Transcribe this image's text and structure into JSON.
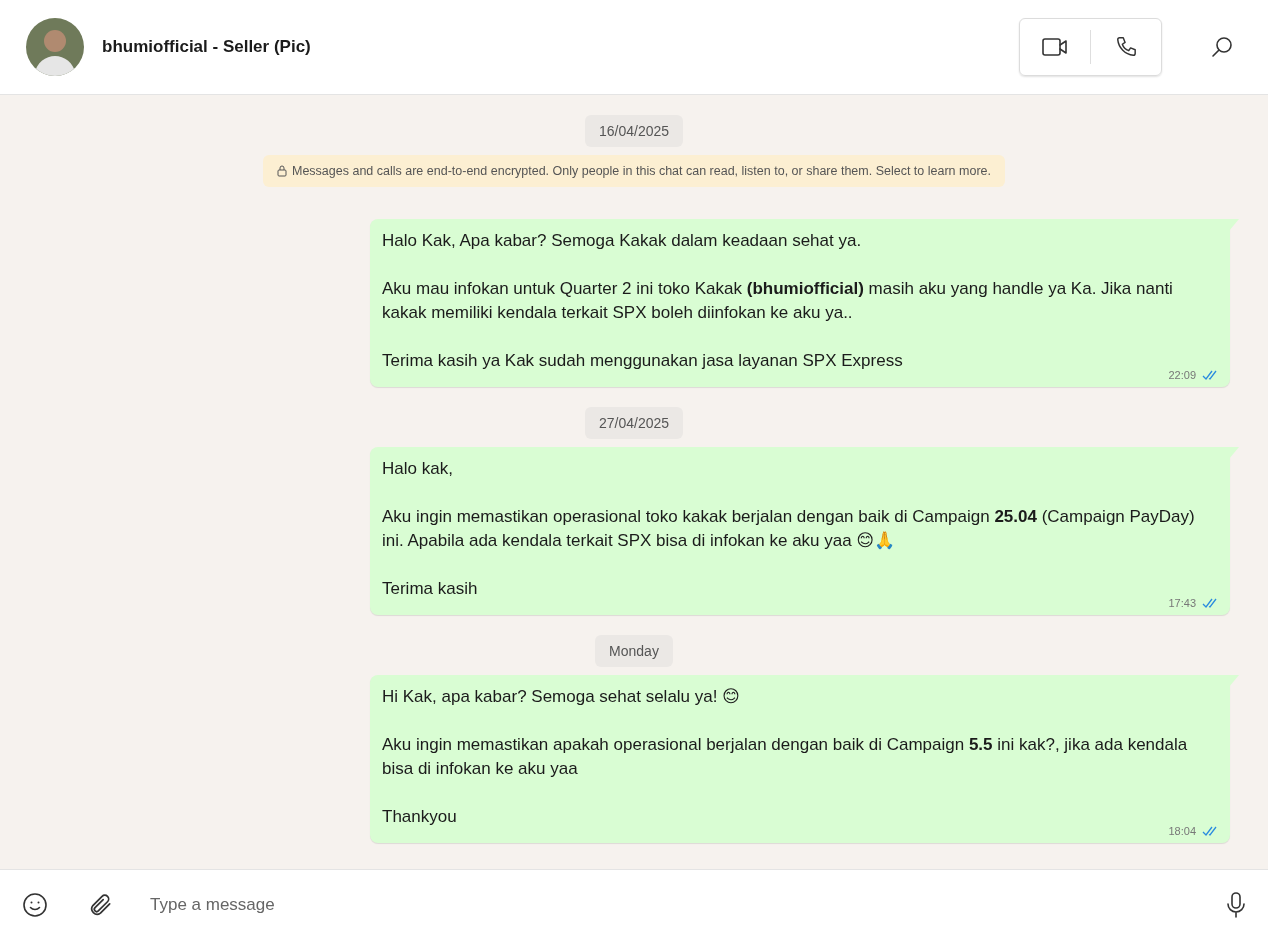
{
  "header": {
    "contact_name": "bhumiofficial - Seller (Pic)"
  },
  "chat": [
    {
      "kind": "date",
      "text": "16/04/2025"
    },
    {
      "kind": "notice",
      "text": "Messages and calls are end-to-end encrypted. Only people in this chat can read, listen to, or share them. Select to learn more."
    },
    {
      "kind": "message",
      "paragraphs": [
        "Halo Kak, Apa kabar? Semoga Kakak dalam keadaan sehat ya.",
        "Aku mau infokan untuk Quarter 2 ini toko Kakak **(bhumiofficial)** masih aku yang handle ya Ka. Jika nanti kakak memiliki kendala terkait SPX boleh diinfokan ke aku ya..",
        "Terima kasih ya Kak sudah menggunakan jasa layanan SPX Express"
      ],
      "time": "22:09",
      "read": true
    },
    {
      "kind": "date",
      "text": "27/04/2025"
    },
    {
      "kind": "message",
      "paragraphs": [
        "Halo kak,",
        "Aku ingin memastikan operasional toko kakak berjalan dengan baik di Campaign **25.04** (Campaign PayDay) ini. Apabila ada kendala terkait SPX bisa di infokan ke aku yaa 😊🙏",
        "Terima kasih"
      ],
      "time": "17:43",
      "read": true
    },
    {
      "kind": "date",
      "text": "Monday"
    },
    {
      "kind": "message",
      "paragraphs": [
        "Hi Kak, apa kabar? Semoga sehat selalu ya! 😊",
        "Aku ingin memastikan apakah operasional berjalan dengan baik di Campaign **5.5** ini kak?, jika ada kendala bisa di infokan ke aku yaa",
        "Thankyou"
      ],
      "time": "18:04",
      "read": true
    }
  ],
  "composer": {
    "placeholder": "Type a message"
  }
}
